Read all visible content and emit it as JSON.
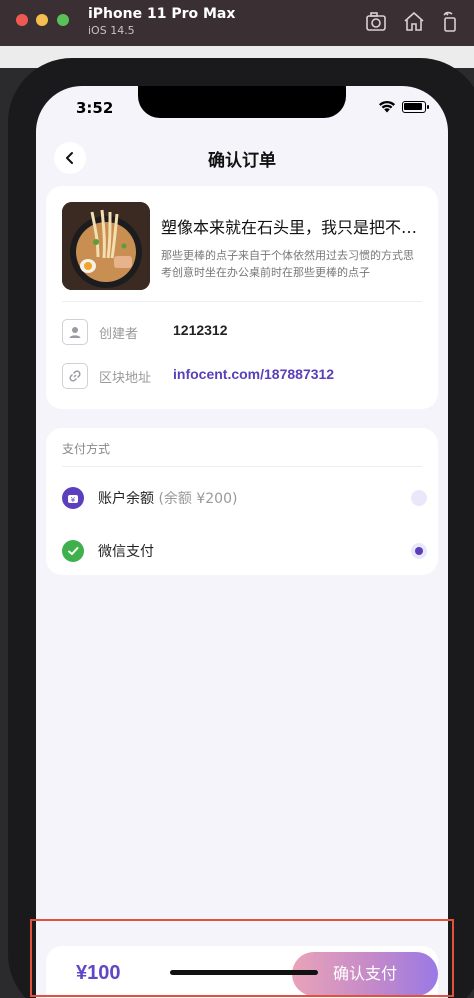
{
  "simulator": {
    "device": "iPhone 11 Pro Max",
    "os": "iOS 14.5",
    "icons": [
      "screenshot-icon",
      "home-icon",
      "rotate-icon"
    ]
  },
  "status_bar": {
    "time": "3:52"
  },
  "nav": {
    "title": "确认订单",
    "back_icon": "chevron-left-icon"
  },
  "order": {
    "title": "塑像本来就在石头里，我只是把不需要的部分去掉",
    "description": "那些更棒的点子来自于个体依然用过去习惯的方式思考创意时坐在办公桌前时在那些更棒的点子",
    "creator_label": "创建者",
    "creator_value": "1212312",
    "address_label": "区块地址",
    "address_value": "infocent.com/187887312"
  },
  "payment": {
    "heading": "支付方式",
    "methods": [
      {
        "label": "账户余额",
        "note": "(余额 ¥200)",
        "selected": false,
        "icon": "wallet-icon"
      },
      {
        "label": "微信支付",
        "note": "",
        "selected": true,
        "icon": "wechat-icon"
      }
    ]
  },
  "footer": {
    "price": "¥100",
    "confirm_label": "确认支付"
  },
  "colors": {
    "accent": "#5a3fb8",
    "wechat": "#3fb04b",
    "highlight": "#e0523c"
  }
}
